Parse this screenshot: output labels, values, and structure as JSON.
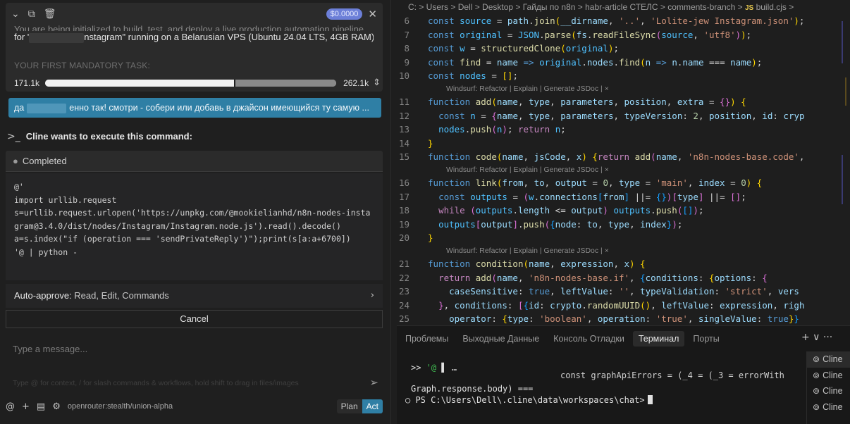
{
  "task": {
    "cost": "$0.0000",
    "text_cut": "You are being initialized to build, test, and deploy a live production automation pipeline",
    "text_prefix": "for '",
    "text_suffix": "nstagram\" running on a Belarusian VPS (Ubuntu 24.04 LTS, 4GB RAM).",
    "subtitle": "YOUR FIRST MANDATORY TASK:",
    "context_used": "171.1k",
    "context_total": "262.1k",
    "context_fraction": 0.653
  },
  "user_message": {
    "prefix": "да",
    "text": "енно так! смотри - собери или добавь в джайсон имеющийся ту самую ..."
  },
  "execute": {
    "title": "Cline wants to execute this command:",
    "status": "Completed",
    "code": "@'\nimport urllib.request\ns=urllib.request.urlopen('https://unpkg.com/@mookielianhd/n8n-nodes-instagram@3.4.0/dist/nodes/Instagram/Instagram.node.js').read().decode()\na=s.index(\"if (operation === 'sendPrivateReply')\");print(s[a:a+6700])\n'@ | python -"
  },
  "auto_approve": {
    "label": "Auto-approve:",
    "value": "Read, Edit, Commands"
  },
  "cancel_label": "Cancel",
  "composer": {
    "placeholder": "Type a message...",
    "hint": "Type @ for context, / for slash commands & workflows, hold shift to drag in files/images",
    "model": "openrouter:stealth/union-alpha",
    "plan_label": "Plan",
    "act_label": "Act"
  },
  "editor": {
    "breadcrumb": "C: > Users > Dell > Desktop > Гайды по n8n > habr-article СТЕЛС > comments-branch >",
    "js_badge": "JS",
    "file": "build.cjs >",
    "codelens": "Windsurf: Refactor | Explain | Generate JSDoc | ×",
    "line_numbers": [
      "6",
      "7",
      "8",
      "9",
      "10",
      "11",
      "12",
      "13",
      "14",
      "15",
      "16",
      "17",
      "18",
      "19",
      "20",
      "21",
      "22",
      "23",
      "24",
      "25"
    ]
  },
  "panel": {
    "tabs": [
      "Проблемы",
      "Выходные Данные",
      "Консоль Отладки",
      "Терминал",
      "Порты"
    ],
    "active_tab": "Терминал",
    "actions": "+ ∨ ···",
    "term_prompt1_a": ">> ",
    "term_prompt1_b": "'@",
    "term_prompt1_c": " ▌ …",
    "term_out1": "const graphApiErrors = (_4 = (_3 = errorWith",
    "term_out2": "Graph.response.body) ===",
    "term_prompt2": "○ PS C:\\Users\\Dell\\.cline\\data\\workspaces\\chat>",
    "terminals": [
      "Cline",
      "Cline",
      "Cline",
      "Cline"
    ]
  }
}
